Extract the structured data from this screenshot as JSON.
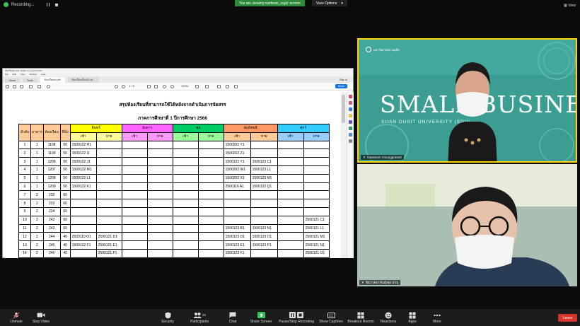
{
  "top": {
    "recording_label": "Recording...",
    "banner": "You are viewing ruwhean_regis' screen",
    "view_options": "View Options",
    "view": "View"
  },
  "acrobat": {
    "title": "ห้องเรียนfix.pdf - Adobe Acrobat Pro DC",
    "menu": [
      "File",
      "Edit",
      "View",
      "Window",
      "Help"
    ],
    "tabs": [
      "Home",
      "Tools",
      "ห้องเรียนfix.pdf",
      "ห้องเรียนเต็มแล้ว.fp..."
    ],
    "sign_in": "Sign In",
    "page": "1",
    "page_of": "/ 6",
    "zoom": "159%",
    "share": "Share"
  },
  "document": {
    "title": "สรุปห้องเรียนที่สามารถใช้ได้หลังจากดำเนินการจัดสรร",
    "subtitle": "ภาคการศึกษาที่ 1 ปีการศึกษา 2566",
    "col_headers": [
      "ลำดับ",
      "อาคาร",
      "ห้องเรียน",
      "ที่นั่ง"
    ],
    "days": [
      "จันทร์",
      "อังคาร",
      "พุธ",
      "พฤหัสบดี",
      "ศุกร์"
    ],
    "slots": [
      "เช้า",
      "บ่าย"
    ],
    "rows": [
      [
        "1",
        "1",
        "1108",
        "50",
        "1500122 H1",
        "",
        "",
        "",
        "",
        "",
        "1500202 Y1",
        "",
        "",
        ""
      ],
      [
        "2",
        "1",
        "1109",
        "50",
        "1500122 I1",
        "",
        "",
        "",
        "",
        "",
        "1500202 Z1",
        "",
        "",
        ""
      ],
      [
        "3",
        "1",
        "1206",
        "50",
        "1500122 J1",
        "",
        "",
        "",
        "",
        "",
        "1500122 Y1",
        "1500123 C1",
        "",
        ""
      ],
      [
        "4",
        "1",
        "1207",
        "50",
        "1500122 M1",
        "",
        "",
        "",
        "",
        "",
        "1500202 W1",
        "1500123 L1",
        "",
        ""
      ],
      [
        "5",
        "1",
        "1208",
        "50",
        "1500122 L1",
        "",
        "",
        "",
        "",
        "",
        "1500202 X1",
        "1500123 M1",
        "",
        ""
      ],
      [
        "6",
        "1",
        "1209",
        "50",
        "1500122 K1",
        "",
        "",
        "",
        "",
        "",
        "2500116 A1",
        "1500122 Q1",
        "",
        ""
      ],
      [
        "7",
        "2",
        "232",
        "60",
        "",
        "",
        "",
        "",
        "",
        "",
        "",
        "",
        "",
        ""
      ],
      [
        "8",
        "2",
        "233",
        "60",
        "",
        "",
        "",
        "",
        "",
        "",
        "",
        "",
        "",
        ""
      ],
      [
        "9",
        "2",
        "234",
        "60",
        "",
        "",
        "",
        "",
        "",
        "",
        "",
        "",
        "",
        ""
      ],
      [
        "10",
        "2",
        "242",
        "60",
        "",
        "",
        "",
        "",
        "",
        "",
        "",
        "",
        "",
        "2500121 C1"
      ],
      [
        "11",
        "2",
        "243",
        "60",
        "",
        "",
        "",
        "",
        "",
        "",
        "1500123 B1",
        "1500123 N1",
        "",
        "2500121 L1"
      ],
      [
        "12",
        "2",
        "244",
        "40",
        "2500119 O1",
        "2500121 D1",
        "",
        "",
        "",
        "",
        "1500123 D1",
        "1500123 O1",
        "",
        "2500121 M1"
      ],
      [
        "13",
        "2",
        "245",
        "40",
        "1500122 F1",
        "2500121 E1",
        "",
        "",
        "",
        "",
        "1500123 E1",
        "1500123 P1",
        "",
        "2500121 N1"
      ],
      [
        "14",
        "2",
        "246",
        "40",
        "",
        "2500121 F1",
        "",
        "",
        "",
        "",
        "1500123 F1",
        "",
        "",
        "2500121 O1"
      ]
    ]
  },
  "video": {
    "tile1_bg": "SMALL BUSINESS SMART",
    "tile1_sub": "SUAN DUSIT UNIVERSITY (SDU)",
    "tile1_logo": "มหาวิทยาลัยสวนดุสิต",
    "tile1_name": "ruwamarn moungprasert",
    "tile2_name": "ชัยวาลพร พันธุ์ทอง สวน"
  },
  "toolbar": {
    "unmute": "Unmute",
    "stop_video": "Stop Video",
    "security": "Security",
    "participants": "Participants",
    "participants_count": "25",
    "chat": "Chat",
    "share_screen": "Share Screen",
    "pause_stop": "Pause/Stop Recording",
    "captions": "Show Captions",
    "breakout": "Breakout Rooms",
    "reactions": "Reactions",
    "apps": "Apps",
    "more": "More",
    "leave": "Leave"
  },
  "colors": {
    "monday": "#ffff00",
    "tuesday": "#ff66ff",
    "wednesday": "#00cc66",
    "thursday": "#ff9966",
    "friday": "#33ccff",
    "share_green": "#39c05a",
    "leave_red": "#d9342b",
    "speaker_border": "#ffd400"
  }
}
